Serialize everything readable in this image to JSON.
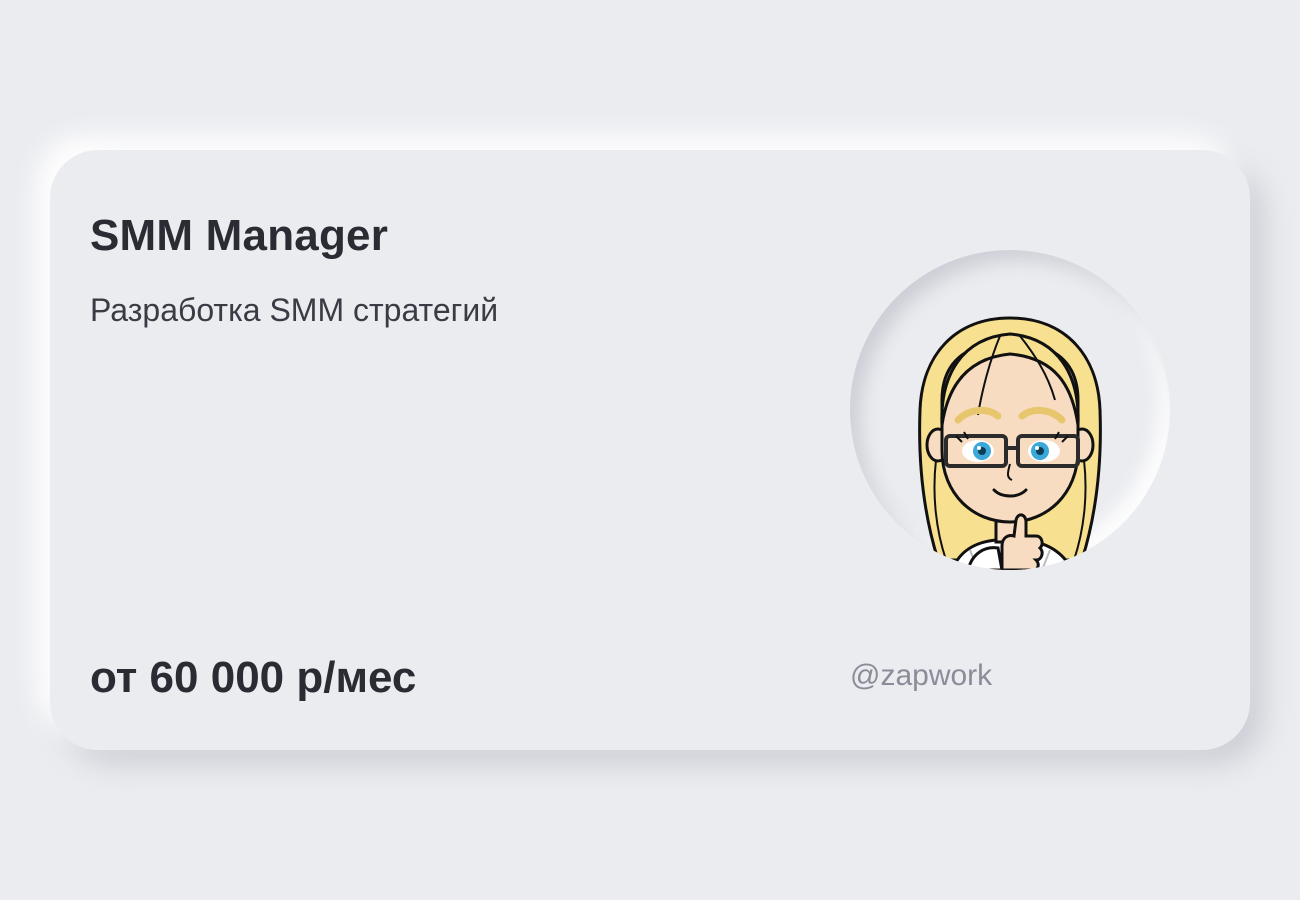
{
  "card": {
    "title": "SMM Manager",
    "subtitle": "Разработка SMM стратегий",
    "price": "от 60 000 р/мес",
    "handle": "@zapwork",
    "avatar_icon": "girl-with-glasses-avatar-icon"
  },
  "colors": {
    "background": "#ebecf0",
    "title_text": "#2a2b33",
    "handle_text": "#8a8d99"
  }
}
